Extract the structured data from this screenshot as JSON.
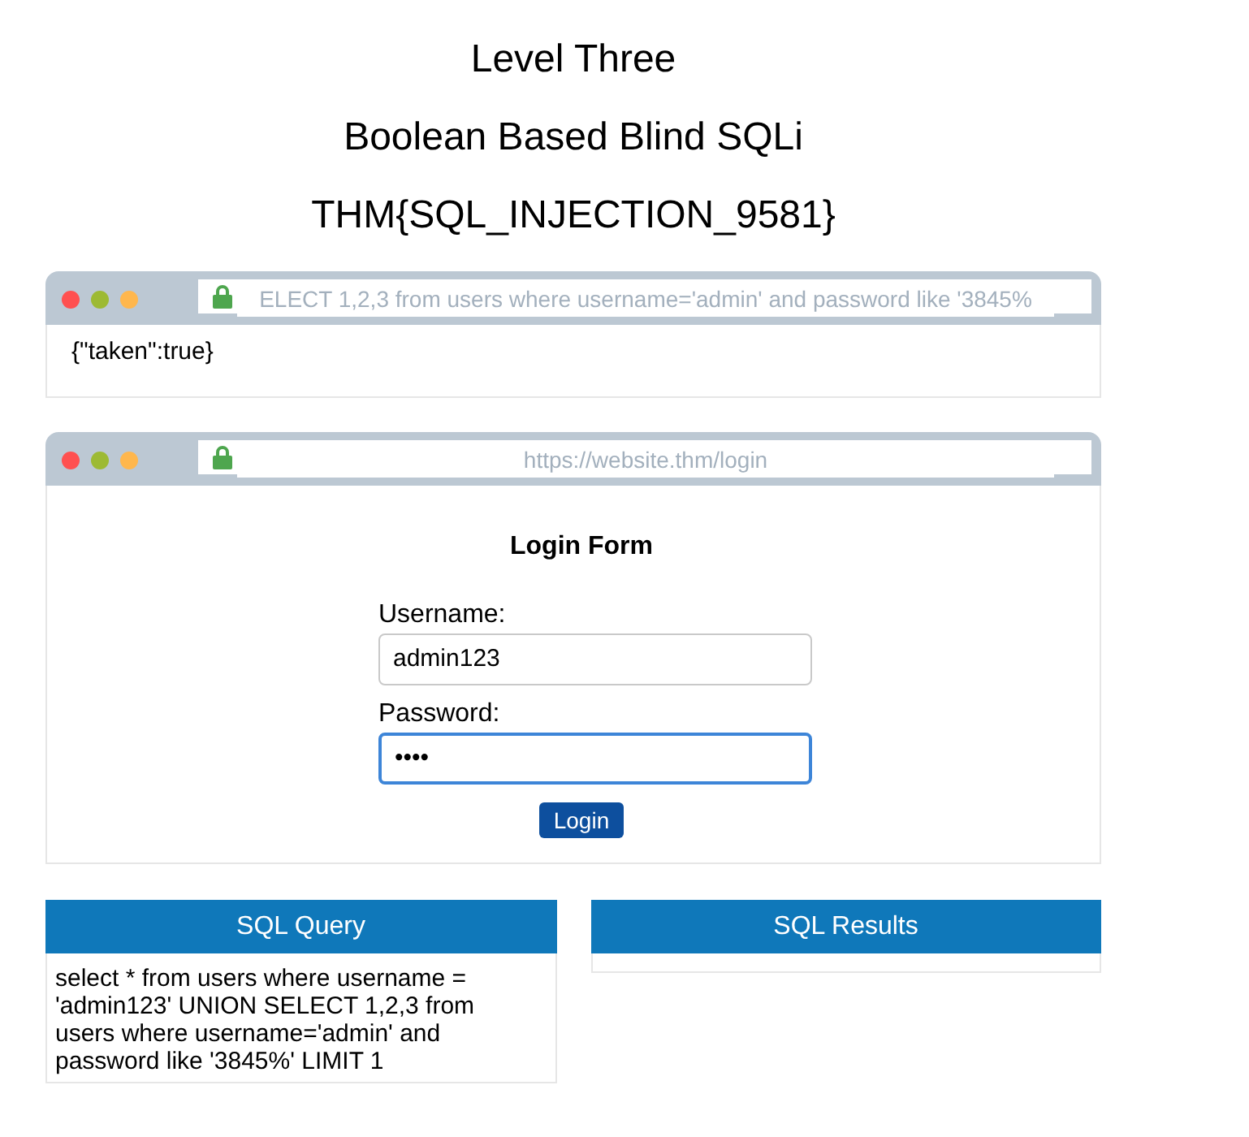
{
  "title": "Level Three",
  "subtitle": "Boolean Based Blind SQLi",
  "flag": "THM{SQL_INJECTION_9581}",
  "response_window": {
    "address": "ELECT 1,2,3 from users where username='admin' and password like '3845%",
    "body": "{\"taken\":true}"
  },
  "login_window": {
    "address": "https://website.thm/login",
    "form_title": "Login Form",
    "fields": [
      {
        "label": "Username:",
        "value": "admin123",
        "focused": false
      },
      {
        "label": "Password:",
        "value": "••••",
        "focused": true
      }
    ],
    "button": "Login"
  },
  "panels": [
    {
      "title": "SQL Query",
      "body": "select * from users where username = 'admin123' UNION SELECT 1,2,3 from users where username='admin' and password like '3845%' LIMIT 1"
    },
    {
      "title": "SQL Results"
    }
  ]
}
